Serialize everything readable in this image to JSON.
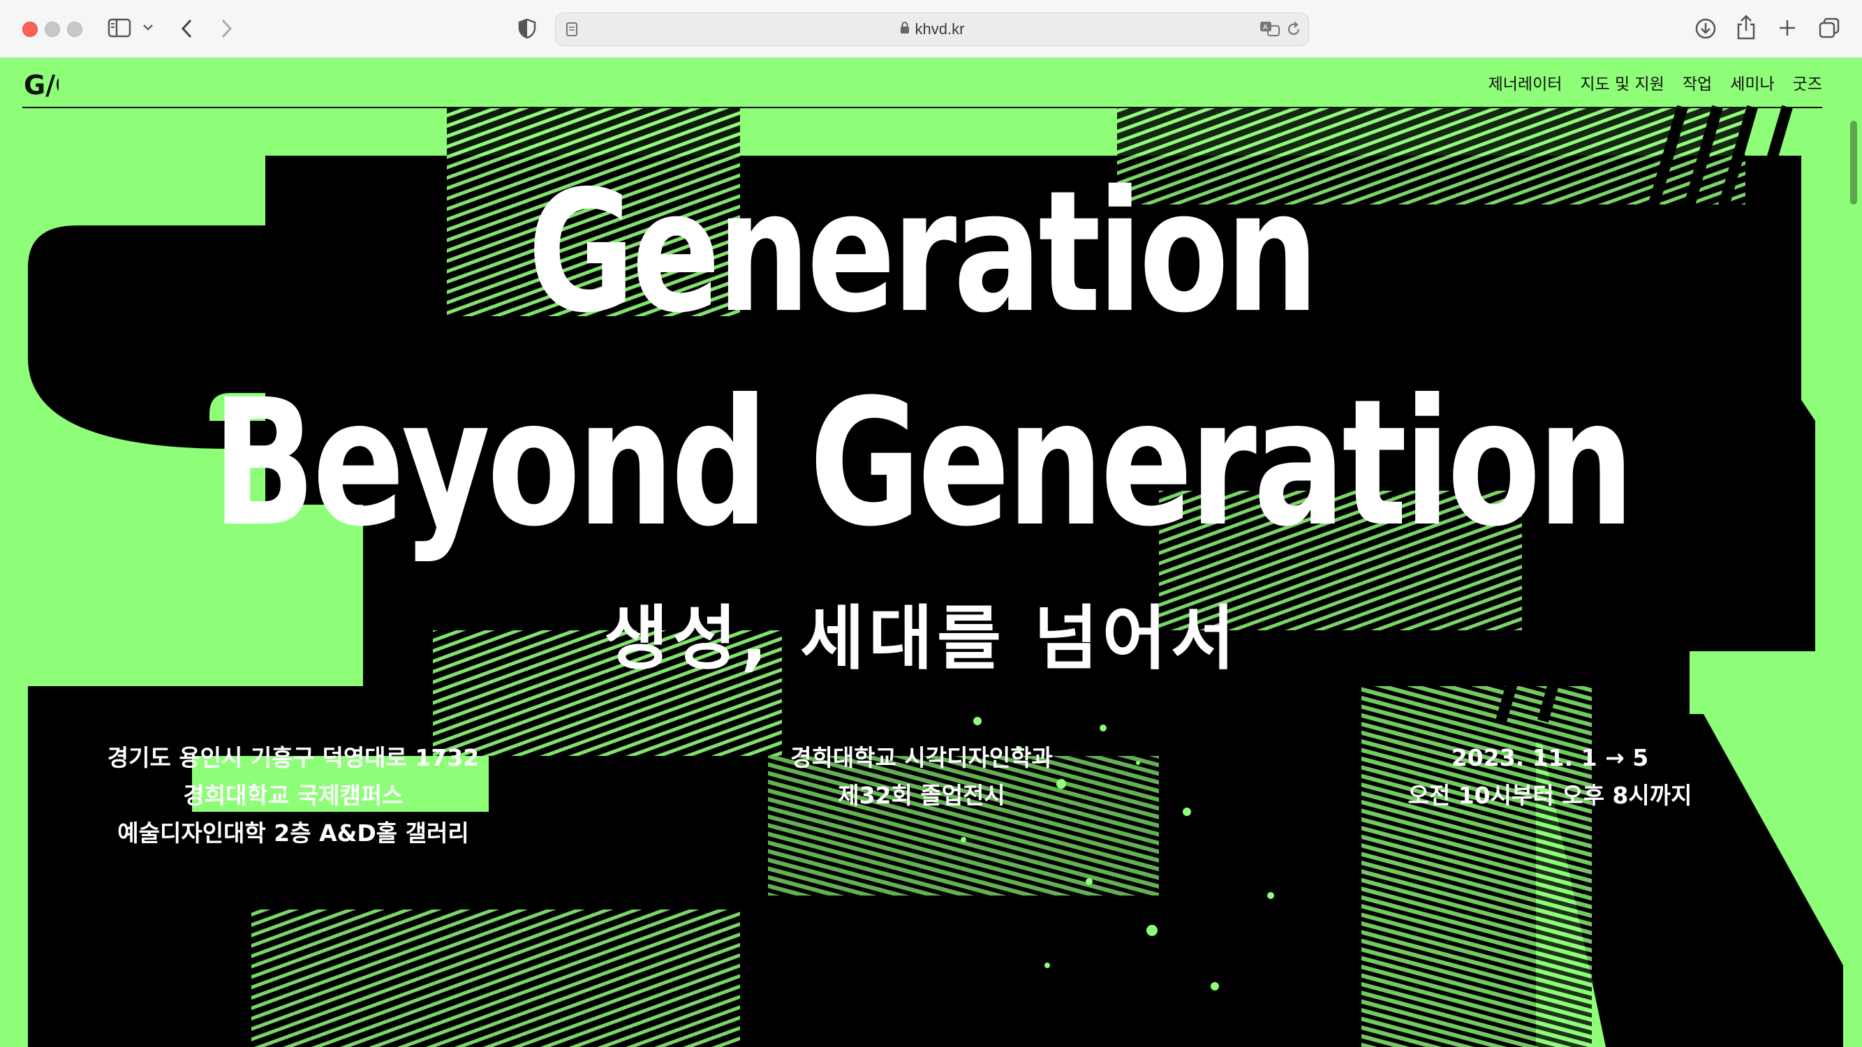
{
  "browser": {
    "url": "khvd.kr",
    "icons": [
      "sidebar-icon",
      "chevron-down-icon",
      "back-icon",
      "forward-icon",
      "shield-icon",
      "page-icon",
      "lock-icon",
      "translate-icon",
      "reload-icon",
      "download-icon",
      "share-icon",
      "new-tab-icon",
      "tabs-overview-icon"
    ]
  },
  "site": {
    "logo": "G/G",
    "nav": [
      "제너레이터",
      "지도 및 지원",
      "작업",
      "세미나",
      "굿즈"
    ]
  },
  "hero": {
    "title_line1": "Generation",
    "title_line2": "Beyond Generation",
    "subtitle": "생성, 세대를 넘어서"
  },
  "info": {
    "location": [
      "경기도 용인시 기흥구 덕영대로 1732",
      "경희대학교 국제캠퍼스",
      "예술디자인대학 2층 A&D홀 갤러리"
    ],
    "event": [
      "경희대학교 시각디자인학과",
      "제32회 졸업전시"
    ],
    "schedule": [
      "2023. 11. 1 → 5",
      "오전 10시부터 오후 8시까지"
    ]
  },
  "colors": {
    "accent": "#8efd78",
    "ink": "#000000",
    "text": "#ffffff"
  }
}
